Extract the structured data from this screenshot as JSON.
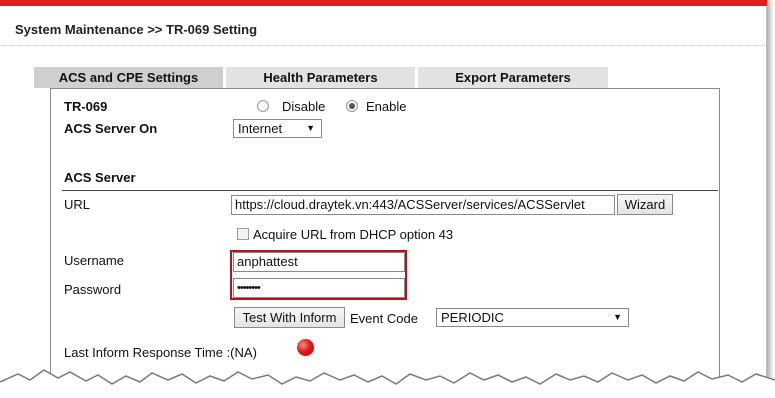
{
  "header": {
    "title": "System Maintenance >> TR-069 Setting"
  },
  "tabs": [
    {
      "label": "ACS and CPE Settings",
      "active": true
    },
    {
      "label": "Health Parameters",
      "active": false
    },
    {
      "label": "Export Parameters",
      "active": false
    }
  ],
  "tr069": {
    "label": "TR-069",
    "options": [
      {
        "label": "Disable",
        "checked": false
      },
      {
        "label": "Enable",
        "checked": true
      }
    ]
  },
  "acs_server_on": {
    "label": "ACS Server On",
    "value": "Internet"
  },
  "acs_server": {
    "section_title": "ACS Server",
    "url_label": "URL",
    "url_value": "https://cloud.draytek.vn:443/ACSServer/services/ACSServlet",
    "wizard_label": "Wizard",
    "dhcp_option_label": "Acquire URL from DHCP option 43",
    "dhcp_option_checked": false,
    "username_label": "Username",
    "username_value": "anphattest",
    "password_label": "Password",
    "password_value": "••••••••",
    "test_button_label": "Test With Inform",
    "event_code_label": "Event Code",
    "event_code_value": "PERIODIC",
    "last_inform_label": "Last Inform Response Time :(NA)"
  },
  "colors": {
    "accent_bar": "#d8211f",
    "highlight_border": "#b0141c",
    "status_dot": "#e21a1a"
  }
}
